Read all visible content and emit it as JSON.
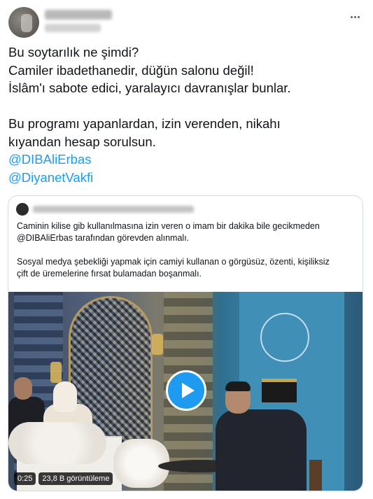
{
  "tweet": {
    "lines": [
      "Bu soytarılık ne şimdi?",
      "Camiler ibadethanedir, düğün salonu değil!",
      "İslâm'ı sabote edici, yaralayıcı davranışlar bunlar.",
      "",
      "Bu programı yapanlardan, izin verenden, nikahı",
      "kıyandan hesap sorulsun."
    ],
    "mentions": [
      "@DIBAliErbas",
      "@DiyanetVakfi"
    ],
    "more_icon": "more-horizontal-icon"
  },
  "quote": {
    "lines": [
      "Caminin kilise gib kullanılmasına izin veren o imam bir dakika bile gecikmeden",
      "@DIBAliErbas tarafından görevden alınmalı.",
      "",
      "Sosyal medya şebekliği yapmak için camiyi kullanan o görgüsüz, özenti, kişiliksiz",
      "çift de üremelerine fırsat bulamadan boşanmalı."
    ],
    "video": {
      "duration": "0:25",
      "views": "23,8 B görüntüleme",
      "play_icon": "play-icon",
      "play_color": "#1d9bf0"
    }
  },
  "colors": {
    "text": "#0f1419",
    "link": "#1d9bf0",
    "border": "#cfd9de"
  }
}
